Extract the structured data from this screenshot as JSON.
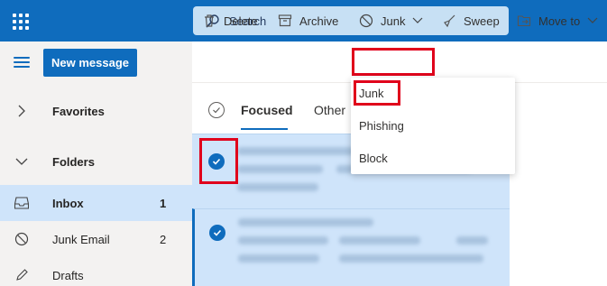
{
  "topbar": {
    "app_launcher_icon": "waffle-icon",
    "search_placeholder": "Search",
    "search_icon": "search-icon",
    "color": "#0f6cbd"
  },
  "leftnav": {
    "menu_icon": "hamburger-icon",
    "new_message_label": "New message",
    "items": [
      {
        "label": "Favorites",
        "icon": "chevron-right-icon",
        "count": ""
      },
      {
        "label": "Folders",
        "icon": "chevron-down-icon",
        "count": ""
      },
      {
        "label": "Inbox",
        "icon": "inbox-icon",
        "count": "1",
        "selected": true
      },
      {
        "label": "Junk Email",
        "icon": "block-icon",
        "count": "2"
      },
      {
        "label": "Drafts",
        "icon": "pencil-icon",
        "count": ""
      }
    ]
  },
  "commandbar": {
    "delete_label": "Delete",
    "archive_label": "Archive",
    "junk_label": "Junk",
    "sweep_label": "Sweep",
    "moveto_label": "Move to"
  },
  "junk_menu": {
    "items": [
      "Junk",
      "Phishing",
      "Block"
    ]
  },
  "message_list": {
    "tabs": [
      "Focused",
      "Other"
    ],
    "active_tab": "Focused",
    "messages": [
      {
        "selected": true
      },
      {
        "selected": true
      }
    ]
  },
  "colors": {
    "accent": "#0f6cbd",
    "highlight_box": "#e0001b",
    "selected_row": "#cfe4fa"
  }
}
